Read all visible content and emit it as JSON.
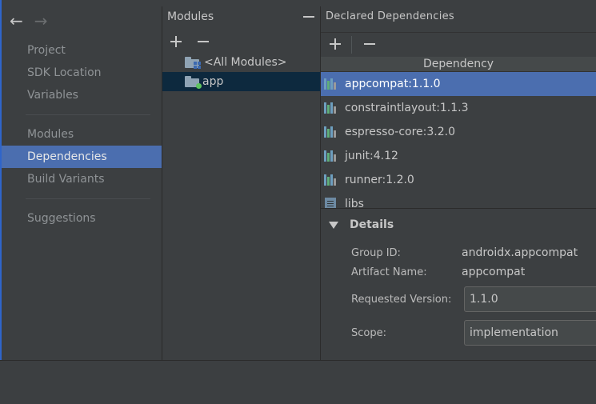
{
  "nav": {
    "back": "←",
    "forward": "→",
    "items": [
      {
        "label": "Project"
      },
      {
        "label": "SDK Location"
      },
      {
        "label": "Variables"
      },
      {
        "label": "Modules"
      },
      {
        "label": "Dependencies",
        "selected": true
      },
      {
        "label": "Build Variants"
      },
      {
        "label": "Suggestions"
      }
    ]
  },
  "modules": {
    "title": "Modules",
    "items": [
      {
        "label": "<All Modules>",
        "icon": "all-modules-folder-icon"
      },
      {
        "label": "app",
        "icon": "app-module-folder-icon",
        "selected": true
      }
    ]
  },
  "dependencies": {
    "title": "Declared Dependencies",
    "column_header": "Dependency",
    "rows": [
      {
        "label": "appcompat:1.1.0",
        "icon": "library-icon",
        "selected": true
      },
      {
        "label": "constraintlayout:1.1.3",
        "icon": "library-icon"
      },
      {
        "label": "espresso-core:3.2.0",
        "icon": "library-icon"
      },
      {
        "label": "junit:4.12",
        "icon": "library-icon"
      },
      {
        "label": "runner:1.2.0",
        "icon": "library-icon"
      },
      {
        "label": "libs",
        "icon": "jar-library-icon"
      }
    ]
  },
  "details": {
    "title": "Details",
    "group_id_label": "Group ID:",
    "group_id": "androidx.appcompat",
    "artifact_label": "Artifact Name:",
    "artifact": "appcompat",
    "version_label": "Requested Version:",
    "version": "1.1.0",
    "scope_label": "Scope:",
    "scope": "implementation"
  },
  "colors": {
    "selection": "#4b6eaf",
    "module_selection": "#0d293e",
    "background": "#3c3f41"
  }
}
